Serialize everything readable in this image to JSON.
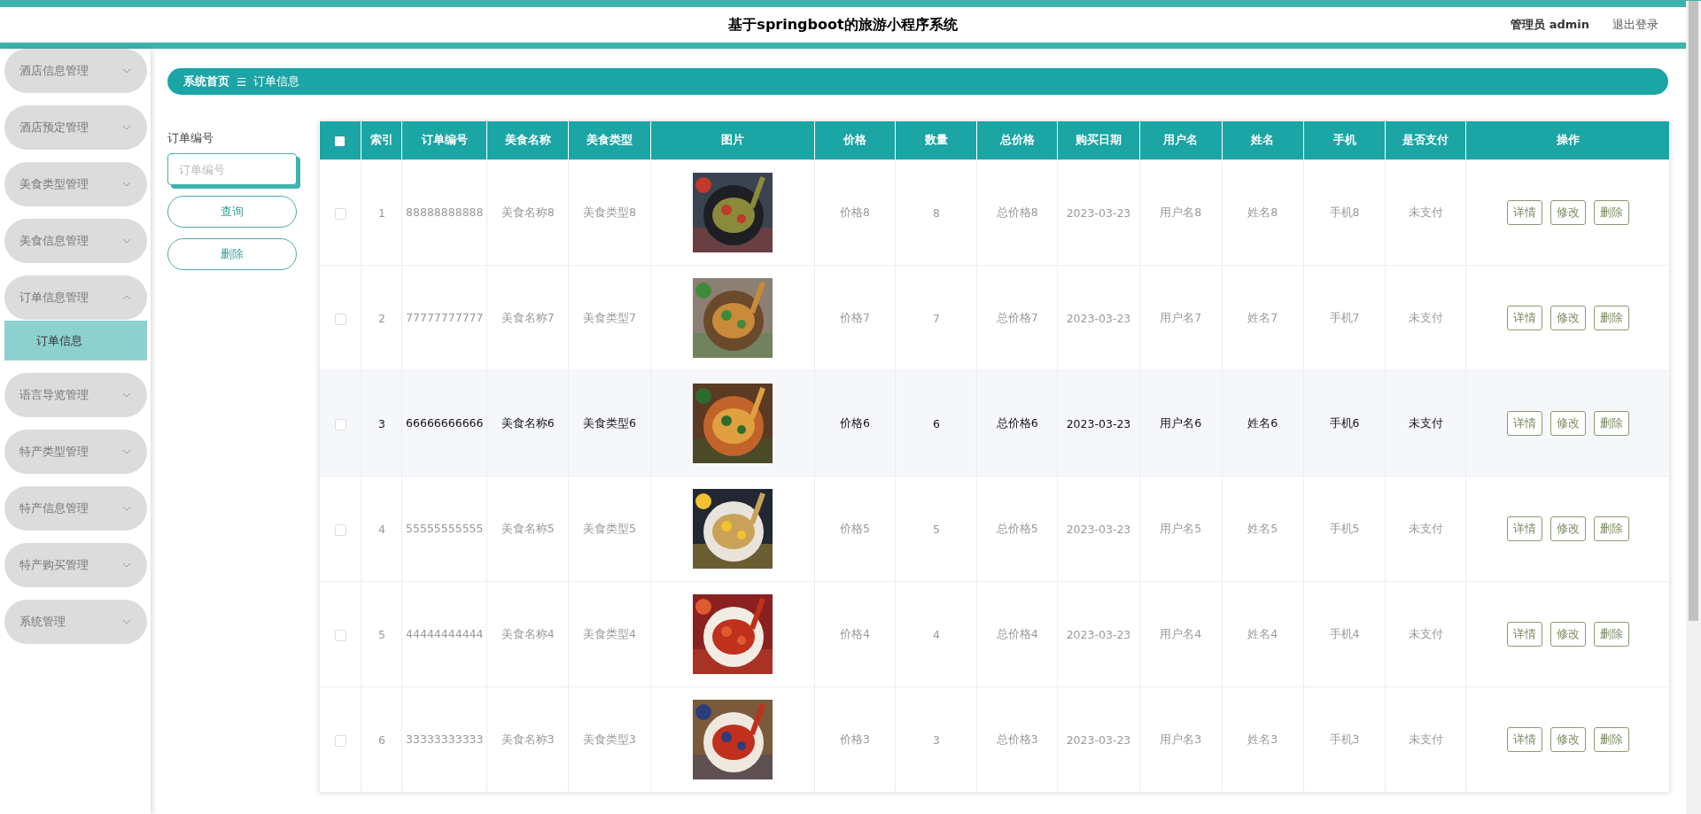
{
  "header": {
    "title": "基于springboot的旅游小程序系统",
    "user": "管理员 admin",
    "logout": "退出登录"
  },
  "sidebar": {
    "items": [
      {
        "label": "酒店信息管理",
        "expanded": false
      },
      {
        "label": "酒店预定管理",
        "expanded": false
      },
      {
        "label": "美食类型管理",
        "expanded": false
      },
      {
        "label": "美食信息管理",
        "expanded": false
      },
      {
        "label": "订单信息管理",
        "expanded": true,
        "children": [
          {
            "label": "订单信息",
            "selected": true
          }
        ]
      },
      {
        "label": "语言导览管理",
        "expanded": false
      },
      {
        "label": "特产类型管理",
        "expanded": false
      },
      {
        "label": "特产信息管理",
        "expanded": false
      },
      {
        "label": "特产购买管理",
        "expanded": false
      },
      {
        "label": "系统管理",
        "expanded": false
      }
    ]
  },
  "breadcrumb": {
    "home": "系统首页",
    "separator": "☰",
    "current": "订单信息"
  },
  "filter": {
    "label": "订单编号",
    "placeholder": "订单编号",
    "search_button": "查询",
    "delete_button": "删除"
  },
  "table": {
    "select_all_checked": false,
    "columns": [
      "索引",
      "订单编号",
      "美食名称",
      "美食类型",
      "图片",
      "价格",
      "数量",
      "总价格",
      "购买日期",
      "用户名",
      "姓名",
      "手机",
      "是否支付",
      "操作"
    ],
    "rows": [
      {
        "checked": false,
        "highlighted": false,
        "cells": [
          "1",
          "88888888888",
          "美食名称8",
          "美食类型8",
          {
            "kind": "picture"
          },
          "价格8",
          "8",
          "总价格8",
          "2023-03-23",
          "用户名8",
          "姓名8",
          "手机8",
          "未支付",
          {
            "kind": "actions",
            "buttons": [
              "详情",
              "修改",
              "删除"
            ]
          }
        ]
      },
      {
        "checked": false,
        "highlighted": false,
        "cells": [
          "2",
          "77777777777",
          "美食名称7",
          "美食类型7",
          {
            "kind": "picture"
          },
          "价格7",
          "7",
          "总价格7",
          "2023-03-23",
          "用户名7",
          "姓名7",
          "手机7",
          "未支付",
          {
            "kind": "actions",
            "buttons": [
              "详情",
              "修改",
              "删除"
            ]
          }
        ]
      },
      {
        "checked": false,
        "highlighted": true,
        "cells": [
          "3",
          "66666666666",
          "美食名称6",
          "美食类型6",
          {
            "kind": "picture"
          },
          "价格6",
          "6",
          "总价格6",
          "2023-03-23",
          "用户名6",
          "姓名6",
          "手机6",
          "未支付",
          {
            "kind": "actions",
            "buttons": [
              "详情",
              "修改",
              "删除"
            ]
          }
        ]
      },
      {
        "checked": false,
        "highlighted": false,
        "cells": [
          "4",
          "55555555555",
          "美食名称5",
          "美食类型5",
          {
            "kind": "picture"
          },
          "价格5",
          "5",
          "总价格5",
          "2023-03-23",
          "用户名5",
          "姓名5",
          "手机5",
          "未支付",
          {
            "kind": "actions",
            "buttons": [
              "详情",
              "修改",
              "删除"
            ]
          }
        ]
      },
      {
        "checked": false,
        "highlighted": false,
        "cells": [
          "5",
          "44444444444",
          "美食名称4",
          "美食类型4",
          {
            "kind": "picture"
          },
          "价格4",
          "4",
          "总价格4",
          "2023-03-23",
          "用户名4",
          "姓名4",
          "手机4",
          "未支付",
          {
            "kind": "actions",
            "buttons": [
              "详情",
              "修改",
              "删除"
            ]
          }
        ]
      },
      {
        "checked": false,
        "highlighted": false,
        "cells": [
          "6",
          "33333333333",
          "美食名称3",
          "美食类型3",
          {
            "kind": "picture"
          },
          "价格3",
          "3",
          "总价格3",
          "2023-03-23",
          "用户名3",
          "姓名3",
          "手机3",
          "未支付",
          {
            "kind": "actions",
            "buttons": [
              "详情",
              "修改",
              "删除"
            ]
          }
        ]
      }
    ]
  }
}
